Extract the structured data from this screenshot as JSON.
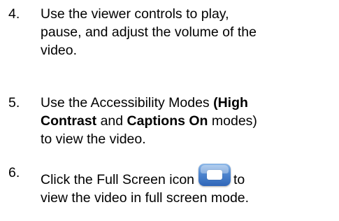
{
  "steps": [
    {
      "number": "4.",
      "lines": [
        "Use the viewer controls to play,",
        "pause, and adjust the volume of the",
        "video."
      ]
    },
    {
      "number": "5.",
      "line1_a": "Use the Accessibility Modes ",
      "line1_b": "(High",
      "line2_a": "Contrast",
      "line2_b": " and ",
      "line2_c": "Captions On",
      "line2_d": " modes)",
      "line3": "to view the video."
    },
    {
      "number": "6.",
      "line1_a": "Click the Full Screen icon",
      "line1_b": "to",
      "line2": "view the video in full screen mode.",
      "icon": "full-screen-icon"
    }
  ]
}
